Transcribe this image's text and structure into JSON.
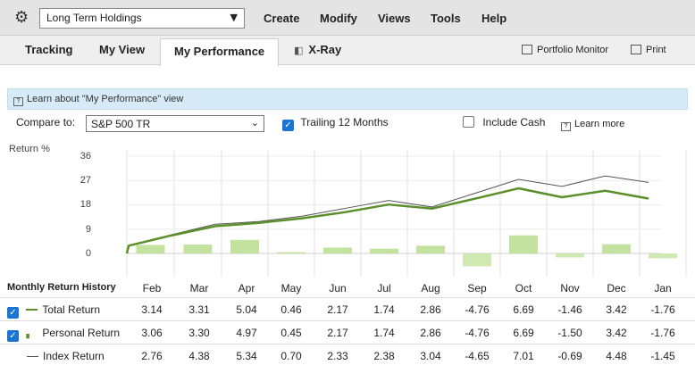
{
  "topbar": {
    "portfolio": "Long Term Holdings",
    "menus": [
      "Create",
      "Modify",
      "Views",
      "Tools",
      "Help"
    ]
  },
  "tabs": {
    "tracking": "Tracking",
    "my_view": "My View",
    "my_performance": "My Performance",
    "xray": "X-Ray",
    "portfolio_monitor": "Portfolio Monitor",
    "print": "Print"
  },
  "learn": {
    "text": "Learn about \"My Performance\" view"
  },
  "controls": {
    "compare_label": "Compare to:",
    "compare_value": "S&P 500 TR",
    "trailing_label": "Trailing 12 Months",
    "trailing_checked": true,
    "include_cash_label": "Include Cash",
    "include_cash_checked": false,
    "learn_more": "Learn more"
  },
  "colors": {
    "personal": "#5a8f2a",
    "index": "#555555",
    "bar": "#b7dc8c",
    "accent": "#1b74d4"
  },
  "chart_data": {
    "type": "line",
    "ylabel": "Return %",
    "yticks": [
      36,
      27,
      18,
      9,
      0
    ],
    "ylim": [
      -4,
      36
    ],
    "series": [
      {
        "name": "Personal Return",
        "values": [
          3.06,
          6.5,
          10.3,
          11.1,
          13.2,
          15.1,
          18.3,
          16.4,
          20.5,
          23.9,
          21.0,
          23.0,
          20.5
        ]
      },
      {
        "name": "Index Return",
        "values": [
          3.2,
          6.8,
          11.0,
          11.6,
          14.0,
          16.5,
          19.8,
          17.0,
          22.5,
          27.2,
          25.0,
          28.5,
          26.5
        ]
      }
    ],
    "bars": [
      3.14,
      3.31,
      5.04,
      0.46,
      2.17,
      1.74,
      2.86,
      -4.76,
      6.69,
      -1.46,
      3.42,
      -1.76
    ]
  },
  "table": {
    "header": "Monthly Return History",
    "months": [
      "Feb",
      "Mar",
      "Apr",
      "May",
      "Jun",
      "Jul",
      "Aug",
      "Sep",
      "Oct",
      "Nov",
      "Dec",
      "Jan"
    ],
    "rows": [
      {
        "label": "Total Return",
        "checked": true,
        "values": [
          "3.14",
          "3.31",
          "5.04",
          "0.46",
          "2.17",
          "1.74",
          "2.86",
          "-4.76",
          "6.69",
          "-1.46",
          "3.42",
          "-1.76"
        ]
      },
      {
        "label": "Personal Return",
        "checked": true,
        "values": [
          "3.06",
          "3.30",
          "4.97",
          "0.45",
          "2.17",
          "1.74",
          "2.86",
          "-4.76",
          "6.69",
          "-1.50",
          "3.42",
          "-1.76"
        ]
      },
      {
        "label": "Index Return",
        "checked": false,
        "values": [
          "2.76",
          "4.38",
          "5.34",
          "0.70",
          "2.33",
          "2.38",
          "3.04",
          "-4.65",
          "7.01",
          "-0.69",
          "4.48",
          "-1.45"
        ]
      }
    ]
  }
}
